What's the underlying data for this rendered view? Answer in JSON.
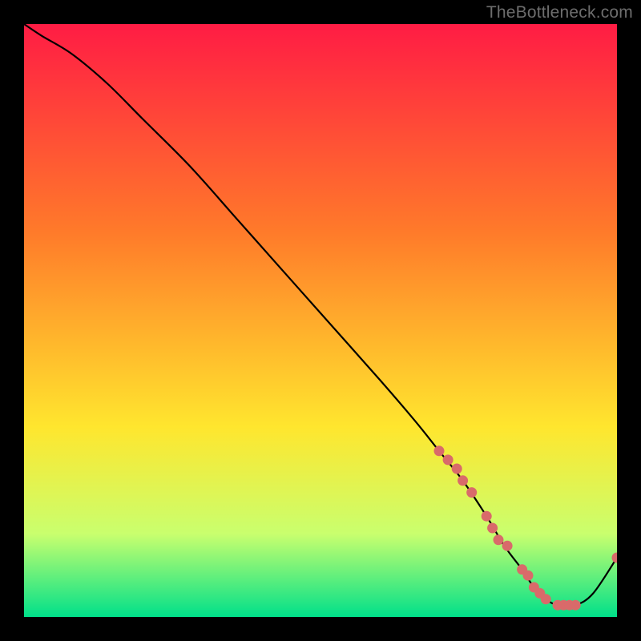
{
  "watermark": "TheBottleneck.com",
  "colors": {
    "grad_top": "#ff1c44",
    "grad_mid1": "#ff7a2a",
    "grad_mid2": "#ffe62e",
    "grad_mid3": "#c9ff6e",
    "grad_bottom": "#00e08a",
    "curve": "#000000",
    "dot": "#d96a6a",
    "bg": "#000000"
  },
  "chart_data": {
    "type": "line",
    "title": "",
    "xlabel": "",
    "ylabel": "",
    "xlim": [
      0,
      100
    ],
    "ylim": [
      0,
      100
    ],
    "x": [
      0,
      3,
      8,
      14,
      20,
      28,
      36,
      44,
      52,
      60,
      66,
      70,
      74,
      78,
      81,
      84,
      86,
      88,
      90,
      93,
      96,
      100
    ],
    "y": [
      100,
      98,
      95,
      90,
      84,
      76,
      67,
      58,
      49,
      40,
      33,
      28,
      23,
      17,
      12,
      8,
      5,
      3,
      2,
      2,
      4,
      10
    ],
    "dots_x": [
      70,
      71.5,
      73,
      74,
      75.5,
      78,
      79,
      80,
      81.5,
      84,
      85,
      86,
      87,
      88,
      90,
      91,
      92,
      93,
      100
    ],
    "dots_y": [
      28,
      26.5,
      25,
      23,
      21,
      17,
      15,
      13,
      12,
      8,
      7,
      5,
      4,
      3,
      2,
      2,
      2,
      2,
      10
    ]
  }
}
